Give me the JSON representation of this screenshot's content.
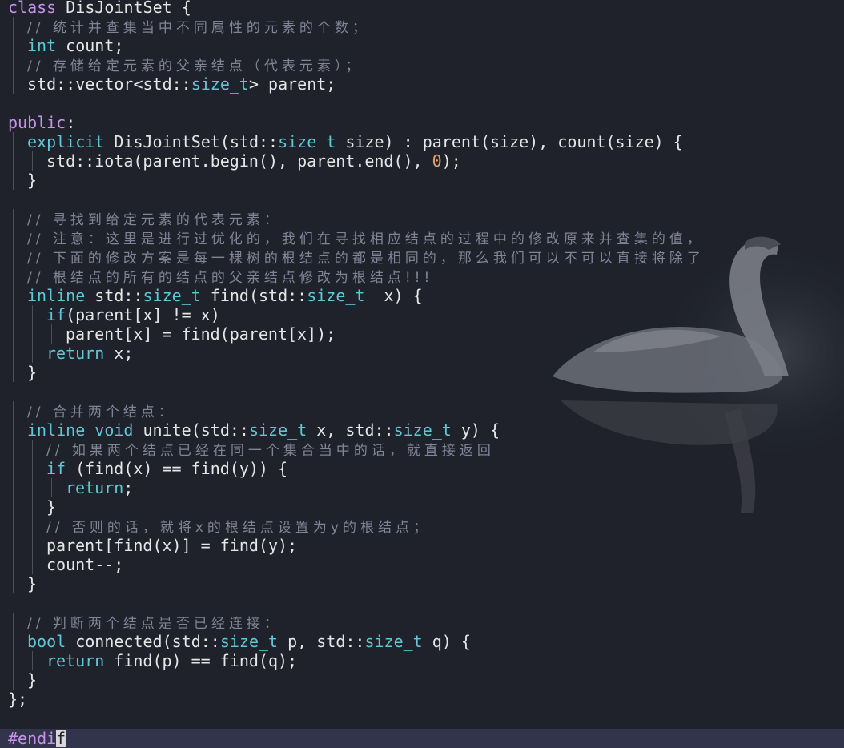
{
  "editor": {
    "theme_colors": {
      "background": "#1f222a",
      "keyword": "#c792ea",
      "type": "#5fc8d6",
      "number": "#e8a070",
      "comment": "#7f8596",
      "text": "#e6e6e6",
      "statusbar": "#31344a"
    },
    "lines": [
      {
        "indent": 0,
        "segs": [
          [
            "kw",
            "class"
          ],
          [
            "pl",
            " DisJointSet {"
          ]
        ]
      },
      {
        "indent": 1,
        "segs": [
          [
            "cm",
            "// 统计并查集当中不同属性的元素的个数；"
          ]
        ]
      },
      {
        "indent": 1,
        "segs": [
          [
            "ty",
            "int"
          ],
          [
            "pl",
            " count;"
          ]
        ]
      },
      {
        "indent": 1,
        "segs": [
          [
            "cm",
            "// 存储给定元素的父亲结点（代表元素）；"
          ]
        ]
      },
      {
        "indent": 1,
        "segs": [
          [
            "pl",
            "std::vector<std::"
          ],
          [
            "ty",
            "size_t"
          ],
          [
            "pl",
            "> parent;"
          ]
        ]
      },
      {
        "indent": 0,
        "segs": []
      },
      {
        "indent": 0,
        "segs": [
          [
            "kw",
            "public"
          ],
          [
            "pl",
            ":"
          ]
        ]
      },
      {
        "indent": 1,
        "segs": [
          [
            "ty",
            "explicit"
          ],
          [
            "pl",
            " DisJointSet(std::"
          ],
          [
            "ty",
            "size_t"
          ],
          [
            "pl",
            " size) : parent(size), count(size) {"
          ]
        ]
      },
      {
        "indent": 2,
        "segs": [
          [
            "pl",
            "std::iota(parent.begin(), parent.end(), "
          ],
          [
            "num",
            "0"
          ],
          [
            "pl",
            ");"
          ]
        ]
      },
      {
        "indent": 1,
        "segs": [
          [
            "pl",
            "}"
          ]
        ]
      },
      {
        "indent": 0,
        "segs": []
      },
      {
        "indent": 1,
        "segs": [
          [
            "cm",
            "// 寻找到给定元素的代表元素："
          ]
        ]
      },
      {
        "indent": 1,
        "segs": [
          [
            "cm",
            "// 注意：这里是进行过优化的，我们在寻找相应结点的过程中的修改原来并查集的值，"
          ]
        ]
      },
      {
        "indent": 1,
        "segs": [
          [
            "cm",
            "// 下面的修改方案是每一棵树的根结点的都是相同的，那么我们可以不可以直接将除了"
          ]
        ]
      },
      {
        "indent": 1,
        "segs": [
          [
            "cm",
            "// 根结点的所有的结点的父亲结点修改为根结点!!!"
          ]
        ]
      },
      {
        "indent": 1,
        "segs": [
          [
            "ty",
            "inline"
          ],
          [
            "pl",
            " std::"
          ],
          [
            "ty",
            "size_t"
          ],
          [
            "pl",
            " find(std::"
          ],
          [
            "ty",
            "size_t"
          ],
          [
            "pl",
            "  x) {"
          ]
        ]
      },
      {
        "indent": 2,
        "segs": [
          [
            "ty",
            "if"
          ],
          [
            "pl",
            "(parent[x] != x)"
          ]
        ]
      },
      {
        "indent": 3,
        "segs": [
          [
            "pl",
            "parent[x] = find(parent[x]);"
          ]
        ]
      },
      {
        "indent": 2,
        "segs": [
          [
            "ty",
            "return"
          ],
          [
            "pl",
            " x;"
          ]
        ]
      },
      {
        "indent": 1,
        "segs": [
          [
            "pl",
            "}"
          ]
        ]
      },
      {
        "indent": 0,
        "segs": []
      },
      {
        "indent": 1,
        "segs": [
          [
            "cm",
            "// 合并两个结点："
          ]
        ]
      },
      {
        "indent": 1,
        "segs": [
          [
            "ty",
            "inline"
          ],
          [
            "pl",
            " "
          ],
          [
            "ty",
            "void"
          ],
          [
            "pl",
            " unite(std::"
          ],
          [
            "ty",
            "size_t"
          ],
          [
            "pl",
            " x, std::"
          ],
          [
            "ty",
            "size_t"
          ],
          [
            "pl",
            " y) {"
          ]
        ]
      },
      {
        "indent": 2,
        "segs": [
          [
            "cm",
            "// 如果两个结点已经在同一个集合当中的话，就直接返回"
          ]
        ]
      },
      {
        "indent": 2,
        "segs": [
          [
            "ty",
            "if"
          ],
          [
            "pl",
            " (find(x) == find(y)) {"
          ]
        ]
      },
      {
        "indent": 3,
        "segs": [
          [
            "ty",
            "return"
          ],
          [
            "pl",
            ";"
          ]
        ]
      },
      {
        "indent": 2,
        "segs": [
          [
            "pl",
            "}"
          ]
        ]
      },
      {
        "indent": 2,
        "segs": [
          [
            "cm",
            "// 否则的话，就将x的根结点设置为y的根结点；"
          ]
        ]
      },
      {
        "indent": 2,
        "segs": [
          [
            "pl",
            "parent[find(x)] = find(y);"
          ]
        ]
      },
      {
        "indent": 2,
        "segs": [
          [
            "pl",
            "count--;"
          ]
        ]
      },
      {
        "indent": 1,
        "segs": [
          [
            "pl",
            "}"
          ]
        ]
      },
      {
        "indent": 0,
        "segs": []
      },
      {
        "indent": 1,
        "segs": [
          [
            "cm",
            "// 判断两个结点是否已经连接："
          ]
        ]
      },
      {
        "indent": 1,
        "segs": [
          [
            "ty",
            "bool"
          ],
          [
            "pl",
            " connected(std::"
          ],
          [
            "ty",
            "size_t"
          ],
          [
            "pl",
            " p, std::"
          ],
          [
            "ty",
            "size_t"
          ],
          [
            "pl",
            " q) {"
          ]
        ]
      },
      {
        "indent": 2,
        "segs": [
          [
            "ty",
            "return"
          ],
          [
            "pl",
            " find(p) == find(q);"
          ]
        ]
      },
      {
        "indent": 1,
        "segs": [
          [
            "pl",
            "}"
          ]
        ]
      },
      {
        "indent": 0,
        "segs": [
          [
            "pl",
            "};"
          ]
        ]
      }
    ]
  },
  "statusbar": {
    "text": "#endi",
    "cursor_char": "f"
  }
}
